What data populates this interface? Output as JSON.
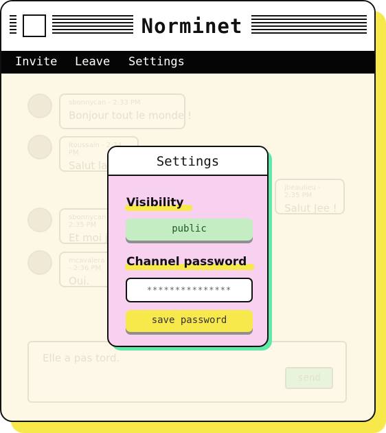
{
  "window": {
    "title": "Norminet",
    "menu": [
      "Invite",
      "Leave",
      "Settings"
    ]
  },
  "chat": {
    "messages": [
      {
        "meta": "sbonnycan - 2:33 PM",
        "text": "Bonjour tout le monde !"
      },
      {
        "meta": "ltoussain - 2:34 PM",
        "text": "Salut la"
      },
      {
        "meta": "jbeaulieu - 2:35 PM",
        "text": "Salut Jee !"
      },
      {
        "meta": "sbonnycan - 2:35 PM",
        "text": "Et moi je"
      },
      {
        "meta": "mcavalera - 2:36 PM",
        "text": "Oui."
      }
    ],
    "composer_text": "Elle a pas tord.",
    "send_label": "send"
  },
  "modal": {
    "title": "Settings",
    "visibility_label": "Visibility",
    "visibility_value": "public",
    "password_label": "Channel password",
    "password_placeholder": "***************",
    "save_label": "save password"
  },
  "colors": {
    "accent_yellow": "#f7e84b",
    "modal_pink": "#f7d1ef",
    "modal_shadow_green": "#5fe8a8",
    "public_green": "#c4edc4",
    "window_bg": "#fdf8e6"
  }
}
